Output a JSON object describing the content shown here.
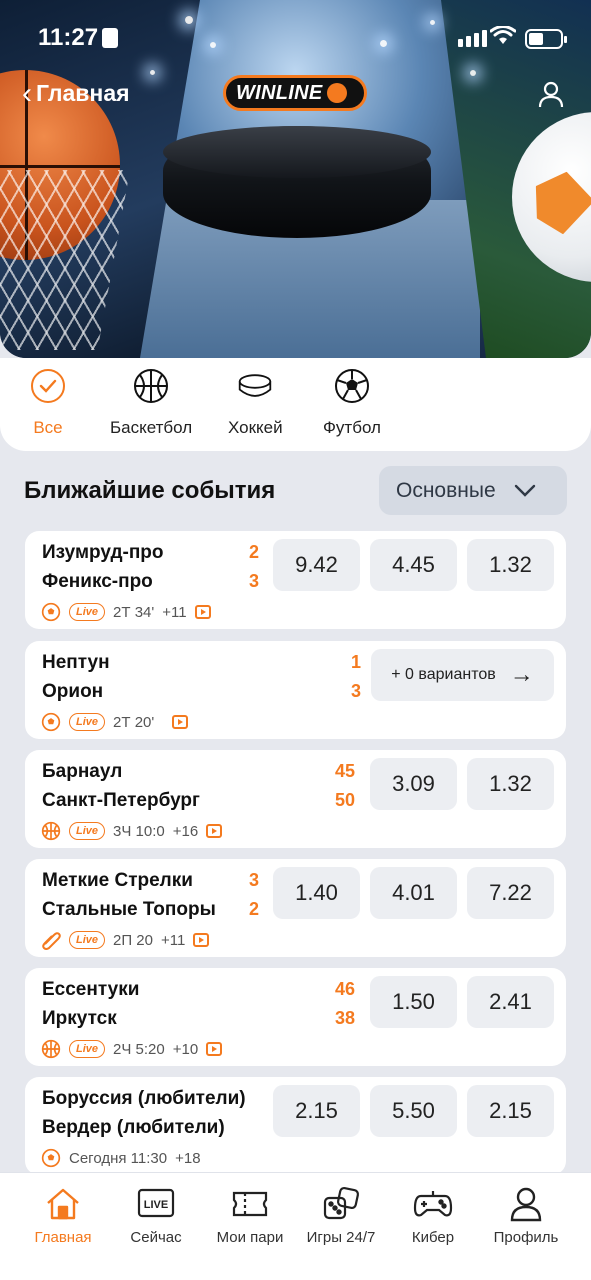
{
  "status_bar": {
    "time": "11:27"
  },
  "header": {
    "back_label": "Главная",
    "logo_text": "WINLINE"
  },
  "categories": [
    {
      "label": "Все",
      "icon": "check-circle-icon",
      "active": true
    },
    {
      "label": "Баскетбол",
      "icon": "basketball-icon"
    },
    {
      "label": "Хоккей",
      "icon": "puck-icon"
    },
    {
      "label": "Футбол",
      "icon": "soccer-ball-icon"
    }
  ],
  "section": {
    "title": "Ближайшие события",
    "filter": "Основные"
  },
  "events": [
    {
      "team1": "Изумруд-про",
      "team2": "Феникс-про",
      "score1": "2",
      "score2": "3",
      "sport_icon": "soccer-ball-icon",
      "live": "Live",
      "time": "2Т 34'",
      "extra": "+11",
      "odds": [
        "9.42",
        "4.45",
        "1.32"
      ]
    },
    {
      "team1": "Нептун",
      "team2": "Орион",
      "score1": "1",
      "score2": "3",
      "sport_icon": "soccer-ball-icon",
      "live": "Live",
      "time": "2Т 20'",
      "extra": "",
      "more": "+ 0 вариантов"
    },
    {
      "team1": "Барнаул",
      "team2": "Санкт-Петербург",
      "score1": "45",
      "score2": "50",
      "sport_icon": "basketball-icon",
      "live": "Live",
      "time": "3Ч 10:0",
      "extra": "+16",
      "odds": [
        "3.09",
        "1.32"
      ]
    },
    {
      "team1": "Меткие Стрелки",
      "team2": "Стальные Топоры",
      "score1": "3",
      "score2": "2",
      "sport_icon": "paperclip-icon",
      "live": "Live",
      "time": "2П 20",
      "extra": "+11",
      "odds": [
        "1.40",
        "4.01",
        "7.22"
      ]
    },
    {
      "team1": "Ессентуки",
      "team2": "Иркутск",
      "score1": "46",
      "score2": "38",
      "sport_icon": "basketball-icon",
      "live": "Live",
      "time": "2Ч 5:20",
      "extra": "+10",
      "odds": [
        "1.50",
        "2.41"
      ]
    },
    {
      "team1": "Боруссия (любители)",
      "team2": "Вердер (любители)",
      "sport_icon": "soccer-ball-icon",
      "time": "Сегодня 11:30",
      "extra": "+18",
      "odds": [
        "2.15",
        "5.50",
        "2.15"
      ]
    }
  ],
  "bottom_nav": [
    {
      "label": "Главная",
      "icon": "home-icon",
      "active": true
    },
    {
      "label": "Сейчас",
      "icon": "live-icon",
      "badge": "LIVE"
    },
    {
      "label": "Мои пари",
      "icon": "ticket-icon"
    },
    {
      "label": "Игры 24/7",
      "icon": "dice-icon"
    },
    {
      "label": "Кибер",
      "icon": "gamepad-icon"
    },
    {
      "label": "Профиль",
      "icon": "user-icon"
    }
  ],
  "colors": {
    "accent": "#f47a1f",
    "background": "#e6e8ee",
    "card": "#ffffff",
    "odd_button": "#eceef2"
  }
}
